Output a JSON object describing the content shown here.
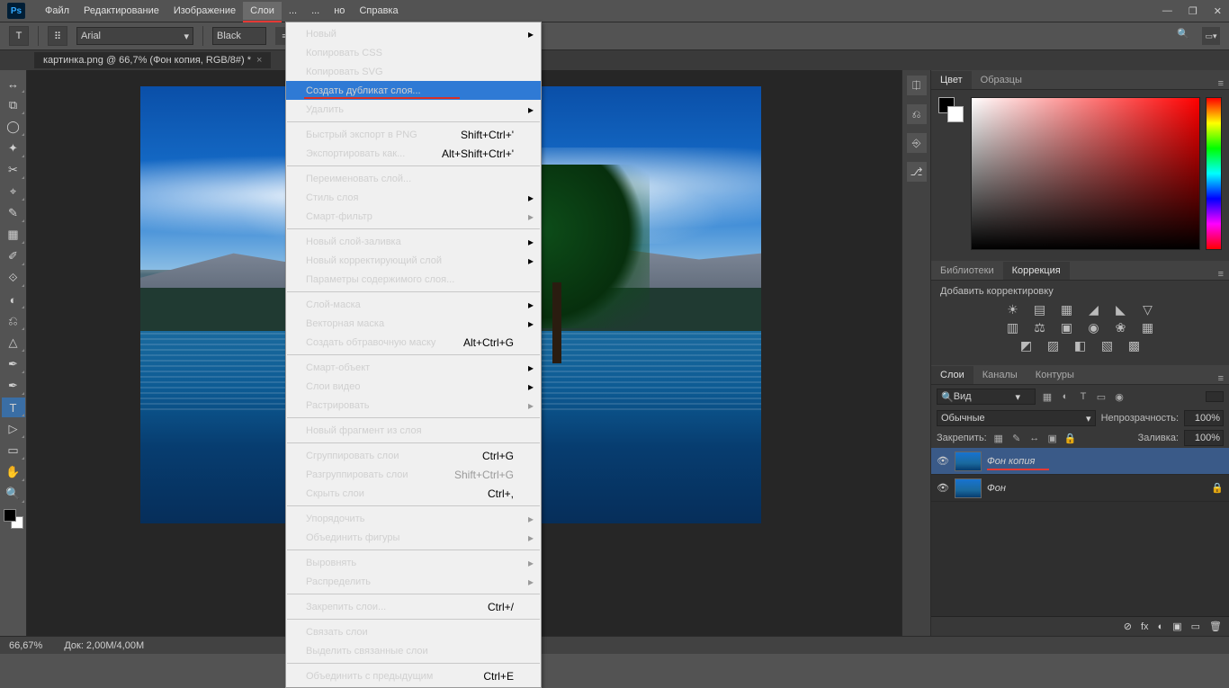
{
  "menubar": {
    "items": [
      "Файл",
      "Редактирование",
      "Изображение",
      "Слои",
      "...",
      "...",
      "но",
      "Справка"
    ],
    "active_index": 3
  },
  "window_controls": {
    "min": "—",
    "max": "❐",
    "close": "✕"
  },
  "options_bar": {
    "tool_glyph": "T",
    "font_family": "Arial",
    "font_style_glyph": "⠿",
    "color_label": "Black",
    "align_glyphs": [
      "≡",
      "≡",
      "≡",
      "≡"
    ],
    "swatch_glyph": "■",
    "warp_glyph": "⎋",
    "panel_glyph": "☰"
  },
  "doc_tab": {
    "title": "картинка.png @ 66,7% (Фон копия, RGB/8#) *",
    "close": "×"
  },
  "tools": {
    "list": [
      "↔",
      "⧉",
      "◯",
      "✦",
      "✂",
      "⌖",
      "✎",
      "▦",
      "✐",
      "⟐",
      "◐",
      "⎌",
      "△",
      "✒",
      "✒",
      "T",
      "▷",
      "▭",
      "✋",
      "🔍"
    ],
    "active_index": 15
  },
  "mini_dock": [
    "⎅",
    "⎌",
    "⎆",
    "⎇"
  ],
  "panels": {
    "color": {
      "tabs": [
        "Цвет",
        "Образцы"
      ],
      "active": 0
    },
    "adjust": {
      "tabs": [
        "Библиотеки",
        "Коррекция"
      ],
      "active": 1,
      "label": "Добавить корректировку",
      "rows": [
        [
          "☀",
          "▤",
          "▦",
          "◢",
          "◣",
          "▽"
        ],
        [
          "▥",
          "⚖",
          "▣",
          "◉",
          "❀",
          "▦"
        ],
        [
          "◩",
          "▨",
          "◧",
          "▧",
          "▩"
        ]
      ]
    },
    "layers": {
      "tabs": [
        "Слои",
        "Каналы",
        "Контуры"
      ],
      "active": 0,
      "search_label": "Вид",
      "filter_glyphs": [
        "▦",
        "◐",
        "T",
        "▭",
        "◉"
      ],
      "blend_mode": "Обычные",
      "opacity_label": "Непрозрачность:",
      "opacity_val": "100%",
      "lock_label": "Закрепить:",
      "lock_glyphs": [
        "▦",
        "✎",
        "↔",
        "▣",
        "🔒"
      ],
      "fill_label": "Заливка:",
      "fill_val": "100%",
      "items": [
        {
          "name": "Фон копия",
          "active": true,
          "locked": false,
          "redline": true
        },
        {
          "name": "Фон",
          "active": false,
          "locked": true,
          "redline": false
        }
      ],
      "bottom_glyphs": [
        "⊘",
        "fx",
        "◐",
        "▣",
        "▭",
        "🗑"
      ]
    }
  },
  "statusbar": {
    "zoom": "66,67%",
    "doc": "Док: 2,00M/4,00M"
  },
  "dropdown": {
    "sections": [
      [
        {
          "label": "Новый",
          "sub": true
        },
        {
          "label": "Копировать CSS"
        },
        {
          "label": "Копировать SVG"
        },
        {
          "label": "Создать дубликат слоя...",
          "highlight": true
        },
        {
          "label": "Удалить",
          "sub": true
        }
      ],
      [
        {
          "label": "Быстрый экспорт в PNG",
          "shortcut": "Shift+Ctrl+'"
        },
        {
          "label": "Экспортировать как...",
          "shortcut": "Alt+Shift+Ctrl+'"
        }
      ],
      [
        {
          "label": "Переименовать слой..."
        },
        {
          "label": "Стиль слоя",
          "sub": true
        },
        {
          "label": "Смарт-фильтр",
          "sub": true,
          "disabled": true
        }
      ],
      [
        {
          "label": "Новый слой-заливка",
          "sub": true
        },
        {
          "label": "Новый корректирующий слой",
          "sub": true
        },
        {
          "label": "Параметры содержимого слоя...",
          "disabled": true
        }
      ],
      [
        {
          "label": "Слой-маска",
          "sub": true
        },
        {
          "label": "Векторная маска",
          "sub": true
        },
        {
          "label": "Создать обтравочную маску",
          "shortcut": "Alt+Ctrl+G"
        }
      ],
      [
        {
          "label": "Смарт-объект",
          "sub": true
        },
        {
          "label": "Слои видео",
          "sub": true
        },
        {
          "label": "Растрировать",
          "sub": true,
          "disabled": true
        }
      ],
      [
        {
          "label": "Новый фрагмент из слоя"
        }
      ],
      [
        {
          "label": "Сгруппировать слои",
          "shortcut": "Ctrl+G"
        },
        {
          "label": "Разгруппировать слои",
          "shortcut": "Shift+Ctrl+G",
          "disabled": true
        },
        {
          "label": "Скрыть слои",
          "shortcut": "Ctrl+,"
        }
      ],
      [
        {
          "label": "Упорядочить",
          "sub": true,
          "disabled": true
        },
        {
          "label": "Объединить фигуры",
          "sub": true,
          "disabled": true
        }
      ],
      [
        {
          "label": "Выровнять",
          "sub": true,
          "disabled": true
        },
        {
          "label": "Распределить",
          "sub": true,
          "disabled": true
        }
      ],
      [
        {
          "label": "Закрепить слои...",
          "shortcut": "Ctrl+/"
        }
      ],
      [
        {
          "label": "Связать слои",
          "disabled": true
        },
        {
          "label": "Выделить связанные слои",
          "disabled": true
        }
      ],
      [
        {
          "label": "Объединить с предыдущим",
          "shortcut": "Ctrl+E"
        }
      ]
    ]
  }
}
